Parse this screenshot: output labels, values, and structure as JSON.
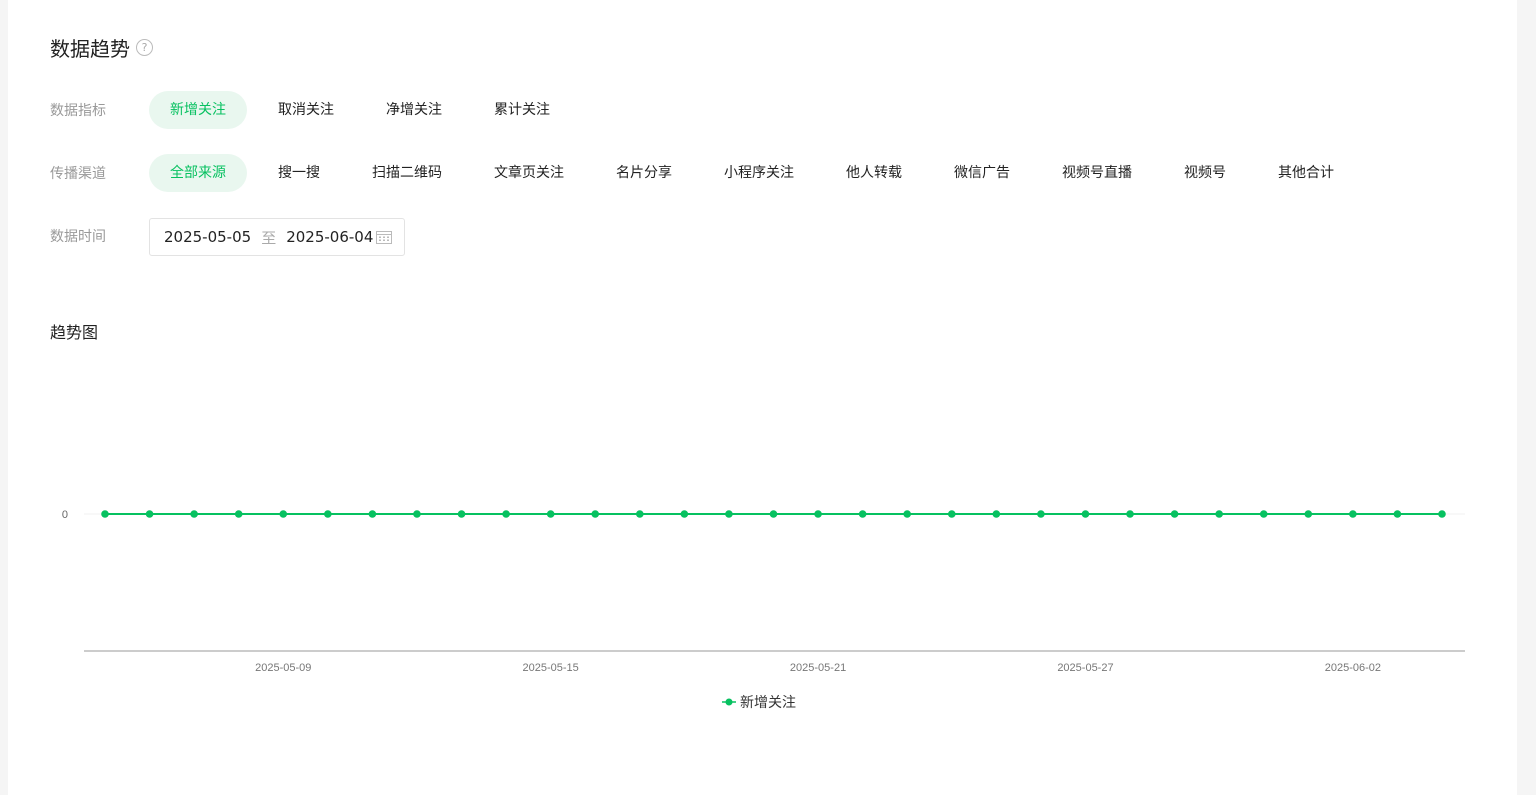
{
  "header": {
    "title": "数据趋势",
    "help_icon": "question-circle-icon"
  },
  "filters": {
    "metric": {
      "label": "数据指标",
      "options": [
        "新增关注",
        "取消关注",
        "净增关注",
        "累计关注"
      ],
      "selected": "新增关注"
    },
    "channel": {
      "label": "传播渠道",
      "options": [
        "全部来源",
        "搜一搜",
        "扫描二维码",
        "文章页关注",
        "名片分享",
        "小程序关注",
        "他人转载",
        "微信广告",
        "视频号直播",
        "视频号",
        "其他合计"
      ],
      "selected": "全部来源"
    },
    "date": {
      "label": "数据时间",
      "start": "2025-05-05",
      "separator": "至",
      "end": "2025-06-04",
      "icon": "calendar-icon"
    }
  },
  "chart_section": {
    "title": "趋势图"
  },
  "colors": {
    "accent": "#07c160",
    "active_pill_bg": "#e9f7ef"
  },
  "chart_data": {
    "type": "line",
    "x": [
      "2025-05-05",
      "2025-05-06",
      "2025-05-07",
      "2025-05-08",
      "2025-05-09",
      "2025-05-10",
      "2025-05-11",
      "2025-05-12",
      "2025-05-13",
      "2025-05-14",
      "2025-05-15",
      "2025-05-16",
      "2025-05-17",
      "2025-05-18",
      "2025-05-19",
      "2025-05-20",
      "2025-05-21",
      "2025-05-22",
      "2025-05-23",
      "2025-05-24",
      "2025-05-25",
      "2025-05-26",
      "2025-05-27",
      "2025-05-28",
      "2025-05-29",
      "2025-05-30",
      "2025-05-31",
      "2025-06-01",
      "2025-06-02",
      "2025-06-03",
      "2025-06-04"
    ],
    "x_ticks": [
      "2025-05-09",
      "2025-05-15",
      "2025-05-21",
      "2025-05-27",
      "2025-06-02"
    ],
    "y_ticks": [
      "0"
    ],
    "series": [
      {
        "name": "新增关注",
        "color": "#07c160",
        "values": [
          0,
          0,
          0,
          0,
          0,
          0,
          0,
          0,
          0,
          0,
          0,
          0,
          0,
          0,
          0,
          0,
          0,
          0,
          0,
          0,
          0,
          0,
          0,
          0,
          0,
          0,
          0,
          0,
          0,
          0,
          0
        ]
      }
    ],
    "legend": "bottom-center",
    "grid": false
  }
}
